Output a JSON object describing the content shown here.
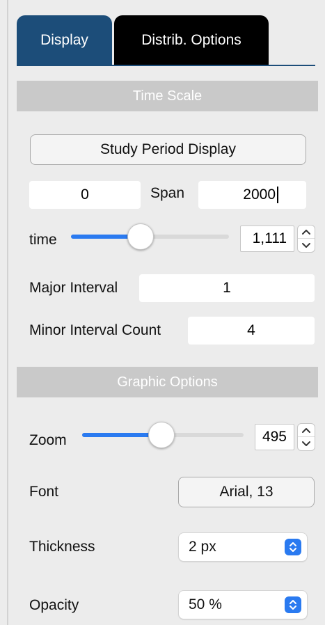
{
  "tabs": [
    {
      "label": "Display",
      "active": true
    },
    {
      "label": "Distrib. Options",
      "active": false
    }
  ],
  "time_scale": {
    "header": "Time Scale",
    "study_period_button": "Study Period Display",
    "start_value": "0",
    "span_label": "Span",
    "span_value": "2000",
    "time_label": "time",
    "time_value": "1,111",
    "time_slider_fraction": 0.44,
    "major_interval_label": "Major Interval",
    "major_interval_value": "1",
    "minor_interval_label": "Minor Interval Count",
    "minor_interval_value": "4"
  },
  "graphic_options": {
    "header": "Graphic Options",
    "zoom_label": "Zoom",
    "zoom_value": "495",
    "zoom_slider_fraction": 0.49,
    "font_label": "Font",
    "font_button": "Arial, 13",
    "thickness_label": "Thickness",
    "thickness_value": "2 px",
    "opacity_label": "Opacity",
    "opacity_value": "50 %"
  },
  "colors": {
    "active_tab": "#1c4d79",
    "inactive_tab": "#000000",
    "accent": "#2a7af0",
    "section_header": "#c9c9c9",
    "background": "#ececec"
  },
  "icons": {
    "stepper": "chevron-up-down-icon",
    "select": "chevron-up-down-icon"
  }
}
